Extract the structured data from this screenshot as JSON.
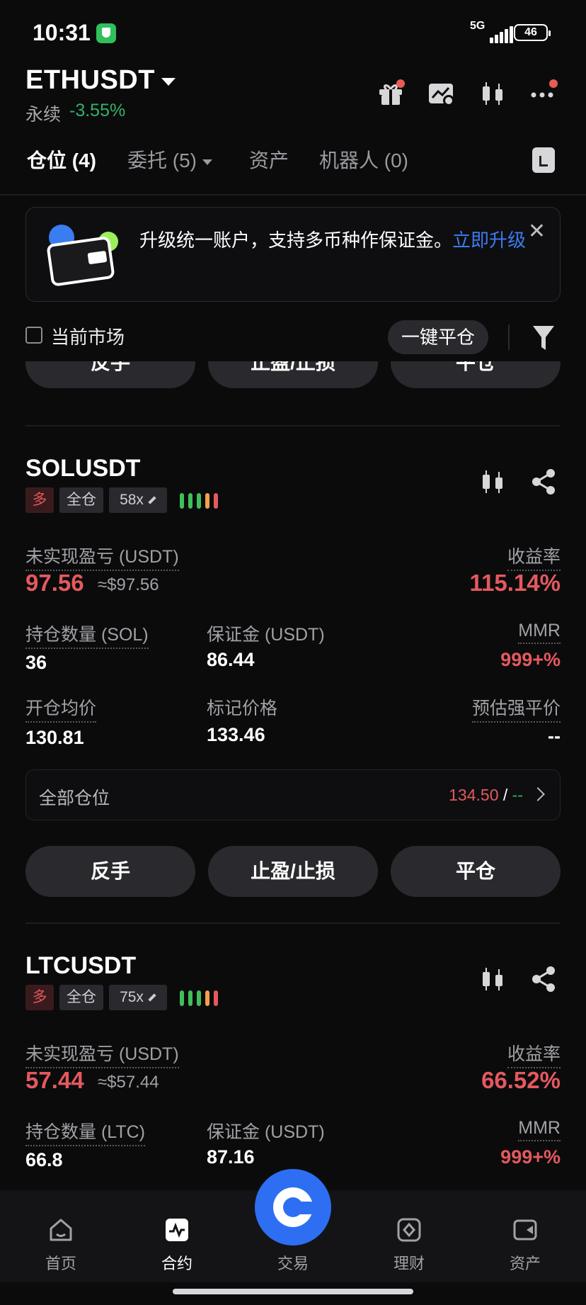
{
  "status": {
    "time": "10:31",
    "network": "5G",
    "battery": "46"
  },
  "header": {
    "pair": "ETHUSDT",
    "type": "永续",
    "change": "-3.55%"
  },
  "tabs": [
    {
      "label": "仓位 (4)"
    },
    {
      "label": "委托 (5)"
    },
    {
      "label": "资产"
    },
    {
      "label": "机器人 (0)"
    }
  ],
  "banner": {
    "text": "升级统一账户，支持多币种作保证金。",
    "link": "立即升级"
  },
  "filter": {
    "current_market": "当前市场",
    "close_all": "一键平仓"
  },
  "actions": {
    "reverse": "反手",
    "tpsl": "止盈/止损",
    "close": "平仓"
  },
  "labels": {
    "unrealized": "未实现盈亏 (USDT)",
    "roe": "收益率",
    "margin": "保证金 (USDT)",
    "mmr": "MMR",
    "entry": "开仓均价",
    "mark": "标记价格",
    "liq": "预估强平价",
    "all_positions": "全部仓位"
  },
  "positions": [
    {
      "symbol": "SOLUSDT",
      "side": "多",
      "mode": "全仓",
      "leverage": "58x",
      "pnl": "97.56",
      "pnl_usd": "≈$97.56",
      "roe": "115.14%",
      "qty_label": "持仓数量 (SOL)",
      "qty": "36",
      "margin": "86.44",
      "mmr": "999+%",
      "entry": "130.81",
      "mark": "133.46",
      "liq": "--",
      "tp": "134.50",
      "sl": "--"
    },
    {
      "symbol": "LTCUSDT",
      "side": "多",
      "mode": "全仓",
      "leverage": "75x",
      "pnl": "57.44",
      "pnl_usd": "≈$57.44",
      "roe": "66.52%",
      "qty_label": "持仓数量 (LTC)",
      "qty": "66.8",
      "margin": "87.16",
      "mmr": "999+%"
    }
  ],
  "nav": [
    {
      "label": "首页"
    },
    {
      "label": "合约"
    },
    {
      "label": "交易"
    },
    {
      "label": "理财"
    },
    {
      "label": "资产"
    }
  ],
  "colors": {
    "up": "#32b26a",
    "down": "#e4595e",
    "accent": "#2e6ef2"
  }
}
